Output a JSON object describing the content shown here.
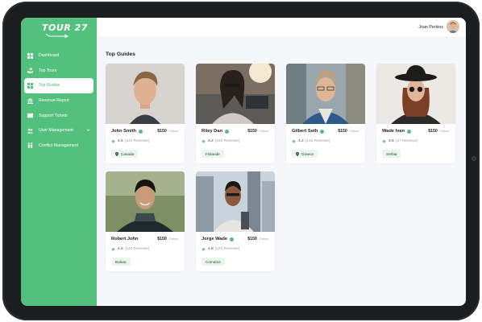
{
  "app": {
    "logo_text": "TOUR 27"
  },
  "colors": {
    "accent": "#54c07d",
    "sidebar_bg": "#54c07d",
    "page_bg": "#f5f7fb"
  },
  "sidebar": {
    "items": [
      {
        "label": "Dashboard",
        "icon": "grid-icon",
        "active": false
      },
      {
        "label": "Top Tours",
        "icon": "hand-icon",
        "active": false
      },
      {
        "label": "Top Guides",
        "icon": "grid-icon",
        "active": true
      },
      {
        "label": "Revenue Report",
        "icon": "bank-icon",
        "active": false
      },
      {
        "label": "Support Tickets",
        "icon": "ticket-icon",
        "active": false
      },
      {
        "label": "User Management",
        "icon": "users-icon",
        "active": false,
        "has_dropdown": true
      },
      {
        "label": "Conflict Management",
        "icon": "conflict-icon",
        "active": false
      }
    ]
  },
  "header": {
    "user_name": "Joan Perkins"
  },
  "main": {
    "section_title": "Top Guides",
    "guides": [
      {
        "name": "John Smith",
        "price": "$150",
        "per": "/Tickets",
        "rating": "4.5",
        "reviews": "(240 Reviews)",
        "country": "Canada",
        "show_pin": true
      },
      {
        "name": "Riley Dan",
        "price": "$150",
        "per": "/Tickets",
        "rating": "3.2",
        "reviews": "(100 Reviews)",
        "country": "Finlande",
        "show_pin": false
      },
      {
        "name": "Gilbert Seth",
        "price": "$150",
        "per": "/Tickets",
        "rating": "4.2",
        "reviews": "(145 Reviews)",
        "country": "Greece",
        "show_pin": true
      },
      {
        "name": "Wade Ivan",
        "price": "$150",
        "per": "/Tickets",
        "rating": "3.5",
        "reviews": "(27 Reviews)",
        "country": "Serbia",
        "show_pin": false
      },
      {
        "name": "Robert John",
        "price": "$150",
        "per": "/Tickets",
        "rating": "4.6",
        "reviews": "(140 Reviews)",
        "country": "Bolivia",
        "show_pin": false
      },
      {
        "name": "Jorge Wade",
        "price": "$150",
        "per": "/Tickets",
        "rating": "4.8",
        "reviews": "(220 Reviews)",
        "country": "Comoros",
        "show_pin": false
      }
    ]
  }
}
